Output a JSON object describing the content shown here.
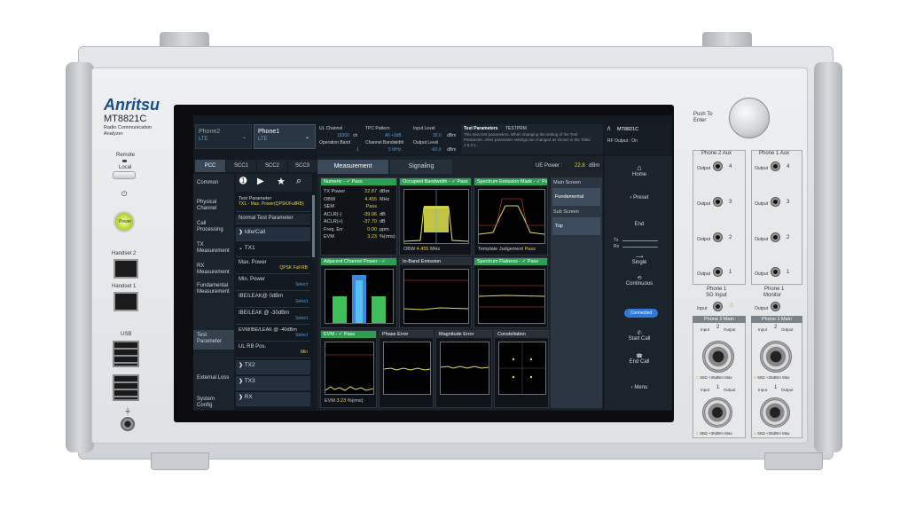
{
  "brand": {
    "logo": "Anritsu",
    "model": "MT8821C",
    "subtitle_1": "Radio Communication",
    "subtitle_2": "Analyzer"
  },
  "left": {
    "remote": "Remote",
    "local": "Local",
    "power": "Power",
    "handset2": "Handset 2",
    "handset1": "Handset 1",
    "usb": "USB"
  },
  "header": {
    "phone2": "Phone2",
    "phone2_sub": "LTE",
    "phone1": "Phone1",
    "phone1_sub": "LTE",
    "ul_channel_label": "UL Channel",
    "ul_channel_value": "18300",
    "ul_channel_unit": "ch",
    "band_label": "Operation Band",
    "band_value": "1",
    "tpc_label": "TPC Pattern",
    "tpc_value": "All +3dB",
    "bw_label": "Channel Bandwidth",
    "bw_value": "5 MHz",
    "input_label": "Input Level",
    "input_value": "30.0",
    "input_unit": "dBm",
    "output_label": "Output Level",
    "output_value": "-60.0",
    "output_unit": "dBm",
    "help_title": "Test Parameters",
    "help_code": "TESTPRM",
    "help_text": "This sets test parameters. When changing the setting of the Test Parameter, other parameter settings are changed as shown in the Table 2.8.2-1.",
    "model": "MT8821C",
    "rf_output": "RF Output : On"
  },
  "carrier_tabs": [
    "PCC",
    "SCC1",
    "SCC2",
    "SCC3"
  ],
  "side_menu": [
    "Common",
    "Physical Channel",
    "Call Processing",
    "TX Measurement",
    "RX Measurement",
    "Fundamental Measurement",
    "",
    "Test Parameter",
    "External Loss",
    "System Config"
  ],
  "params": {
    "tp_label": "Test Parameter",
    "tp_value": "TX1 - Max. Power(QPSK/FullRB)",
    "normal": "Normal Test Parameter",
    "idle": "Idle/Call",
    "tx1": "TX1",
    "max_power": "Max. Power",
    "max_power_val": "QPSK Full RB",
    "min_power": "Min. Power",
    "min_select": "Select",
    "ibe0": "IBE/LEAK@ 0dBm",
    "ibe0_select": "Select",
    "ibe30": "IBE/LEAK @ -30dBm",
    "ibe30_select": "Select",
    "evm40": "EVM/IBE/LEAK @ -40dBm",
    "evm40_select": "Select",
    "ulrb": "UL RB Pos.",
    "ulrb_val": "Min",
    "tx2": "TX2",
    "tx3": "TX3",
    "rx": "RX"
  },
  "meas": {
    "tab_measurement": "Measurement",
    "tab_signaling": "Signaling",
    "ue_power_label": "UE Power :",
    "ue_power_value": "22.8",
    "ue_power_unit": "dBm",
    "numeric_title": "Numeric -",
    "pass": "Pass",
    "numeric_rows": [
      [
        "TX Power",
        "22.87",
        "dBm"
      ],
      [
        "OBW",
        "4.455",
        "MHz"
      ],
      [
        "SEM",
        "Pass",
        ""
      ],
      [
        "ACLR(-)",
        "-39.06",
        "dB"
      ],
      [
        "ACLR(+)",
        "-37.70",
        "dB"
      ],
      [
        "Freq. Err",
        "0.00",
        "ppm"
      ],
      [
        "EVM",
        "3.23",
        "%(rms)"
      ]
    ],
    "obw_title": "Occupied Bandwidth -",
    "obw_foot_label": "OBW",
    "obw_foot_value": "4.455",
    "obw_foot_unit": "MHz",
    "sem_title": "Spectrum Emission Mask -",
    "sem_foot_label": "Template Judgement",
    "sem_foot_value": "Pass",
    "aclr_title": "Adjacent Channel Power -",
    "ibe_title": "In-Band Emission",
    "flat_title": "Spectrum Flatness -",
    "evm_title": "EVM -",
    "phase_title": "Phase Error",
    "mag_title": "Magnitude Error",
    "const_title": "Constellation",
    "evm_foot_label": "EVM",
    "evm_foot_value": "3.23",
    "evm_foot_unit": "%(rms)"
  },
  "screen_nav": {
    "main_screen": "Main Screen",
    "fundamental": "Fundamental",
    "sub_screen": "Sub Screen",
    "top": "Top"
  },
  "right_menu": {
    "home": "Home",
    "preset": "Preset",
    "end": "End",
    "tx": "Tx",
    "rx": "Rx",
    "single": "Single",
    "continuous": "Continuous",
    "connected": "Connected",
    "start_call": "Start Call",
    "end_call": "End Call",
    "menu": "Menu"
  },
  "right_panel": {
    "push": "Push To",
    "enter": "Enter",
    "phone2_aux": "Phone 2 Aux",
    "phone1_aux": "Phone 1 Aux",
    "output": "Output",
    "n4": "4",
    "n3": "3",
    "n2": "2",
    "n1": "1",
    "p1_sg": "Phone 1",
    "p1_sg2": "SG Input",
    "p1_mon": "Phone 1",
    "p1_mon2": "Monitor",
    "input": "Input",
    "phone2_main": "Phone 2 Main",
    "phone1_main": "Phone 1 Main",
    "main_n2": "2",
    "main_n1": "1",
    "warn": "50Ω +35dBm Max"
  }
}
